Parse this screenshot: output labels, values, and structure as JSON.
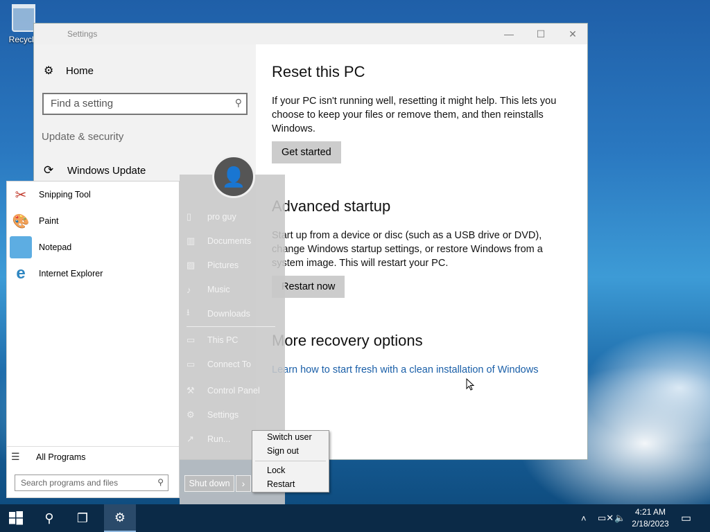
{
  "desktop": {
    "recycle_bin_label": "Recycle"
  },
  "settings": {
    "window_title": "Settings",
    "sidebar": {
      "home_label": "Home",
      "search_placeholder": "Find a setting",
      "section_title": "Update & security",
      "windows_update_label": "Windows Update"
    },
    "reset": {
      "title": "Reset this PC",
      "description": "If your PC isn't running well, resetting it might help. This lets you choose to keep your files or remove them, and then reinstalls Windows.",
      "button": "Get started"
    },
    "advanced": {
      "title": "Advanced startup",
      "description": "Start up from a device or disc (such as a USB drive or DVD), change Windows startup settings, or restore Windows from a system image. This will restart your PC.",
      "button": "Restart now"
    },
    "more": {
      "title": "More recovery options",
      "link": "Learn how to start fresh with a clean installation of Windows"
    }
  },
  "start_menu": {
    "programs": [
      {
        "label": "Snipping Tool",
        "icon": "snipping-tool-icon"
      },
      {
        "label": "Paint",
        "icon": "paint-icon"
      },
      {
        "label": "Notepad",
        "icon": "notepad-icon"
      },
      {
        "label": "Internet Explorer",
        "icon": "internet-explorer-icon"
      }
    ],
    "all_programs": "All Programs",
    "search_placeholder": "Search programs and files",
    "right_items": [
      {
        "label": "pro guy",
        "icon": "user-folder-icon"
      },
      {
        "label": "Documents",
        "icon": "documents-icon"
      },
      {
        "label": "Pictures",
        "icon": "pictures-icon"
      },
      {
        "label": "Music",
        "icon": "music-icon"
      },
      {
        "label": "Downloads",
        "icon": "downloads-icon"
      },
      {
        "label": "This PC",
        "icon": "this-pc-icon"
      },
      {
        "label": "Connect To",
        "icon": "connect-to-icon"
      },
      {
        "label": "Control Panel",
        "icon": "control-panel-icon"
      },
      {
        "label": "Settings",
        "icon": "settings-icon"
      },
      {
        "label": "Run...",
        "icon": "run-icon"
      }
    ],
    "shutdown_label": "Shut down"
  },
  "power_menu": {
    "items": [
      "Switch user",
      "Sign out",
      "Lock",
      "Restart"
    ]
  },
  "taskbar": {
    "time": "4:21 AM",
    "date": "2/18/2023"
  }
}
